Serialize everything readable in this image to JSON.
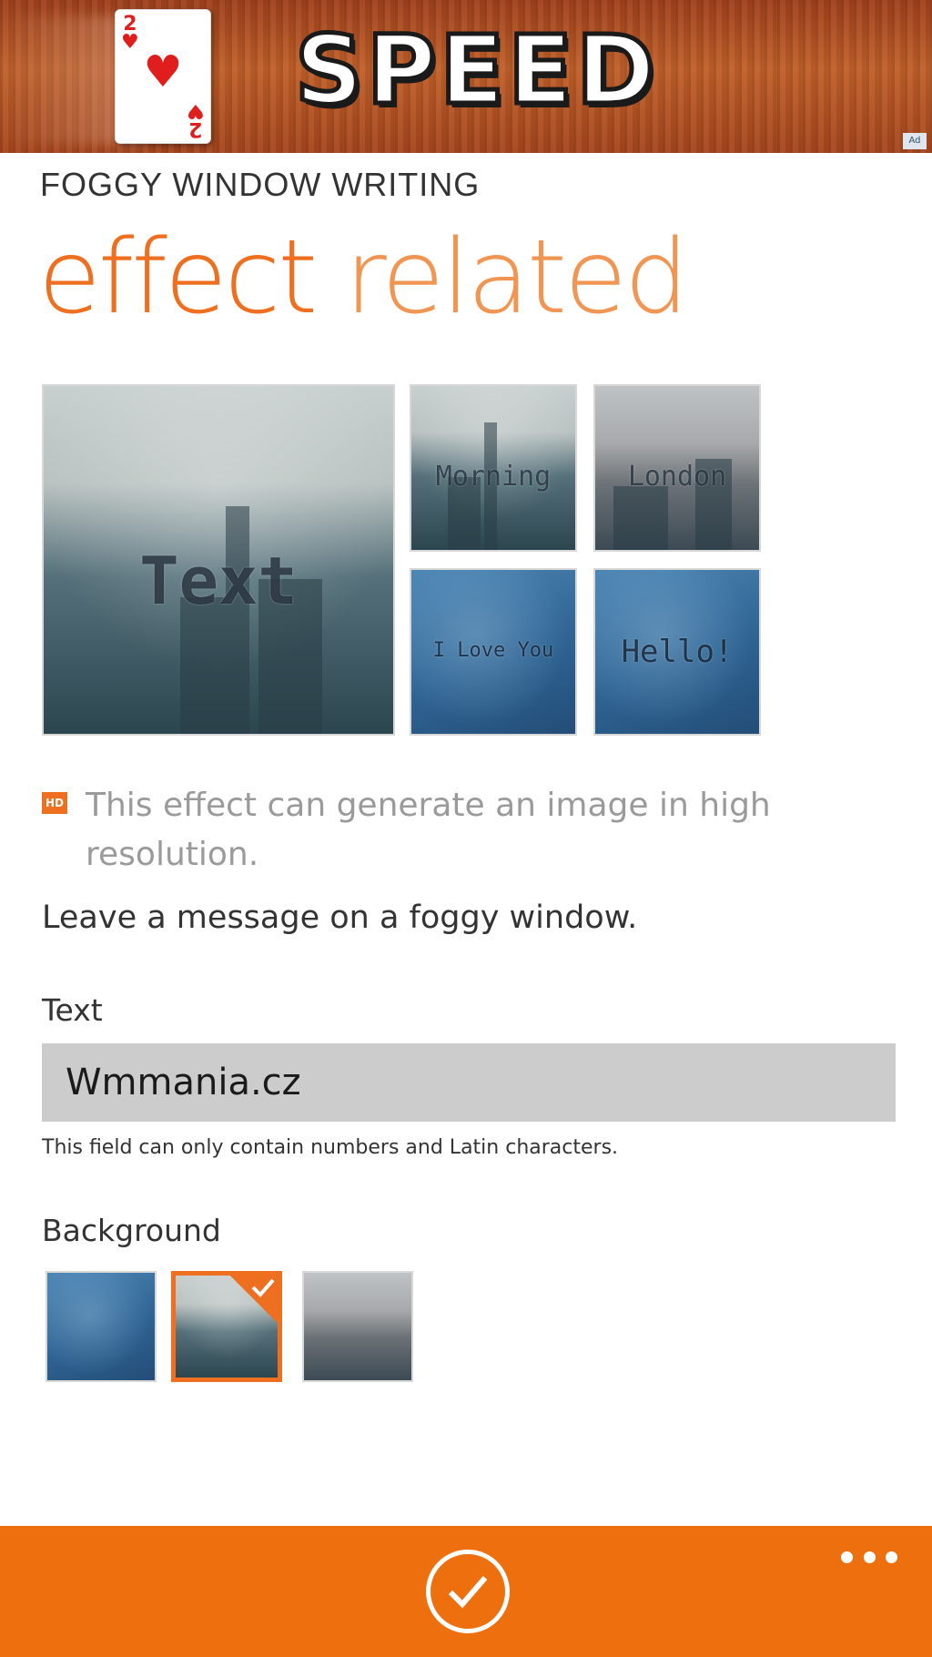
{
  "ad": {
    "title": "SPEED",
    "card_rank": "2",
    "card_suit": "♥",
    "badge": "Ad"
  },
  "header": {
    "app_title": "FOGGY WINDOW WRITING",
    "page_title_word1": "effect",
    "page_title_word2": "related"
  },
  "gallery": {
    "tiles": [
      {
        "caption": "Text"
      },
      {
        "caption": "Morning"
      },
      {
        "caption": "London"
      },
      {
        "caption": "I Love You"
      },
      {
        "caption": "Hello!"
      }
    ]
  },
  "hd_note": {
    "badge": "HD",
    "text": "This effect can generate an image in high resolution."
  },
  "description": "Leave a message on a foggy window.",
  "text_field": {
    "label": "Text",
    "value": "Wmmania.cz",
    "hint": "This field can only contain numbers and Latin characters."
  },
  "background": {
    "label": "Background",
    "options": [
      "blue-fog",
      "city-skyline",
      "london-skyline"
    ],
    "selected": "city-skyline"
  },
  "app_bar": {
    "confirm_icon": "check-circle-icon",
    "more_icon": "ellipsis-icon"
  },
  "colors": {
    "accent": "#ee6f1f",
    "app_bar": "#ee6f0e",
    "input_bg": "#cccccc"
  }
}
